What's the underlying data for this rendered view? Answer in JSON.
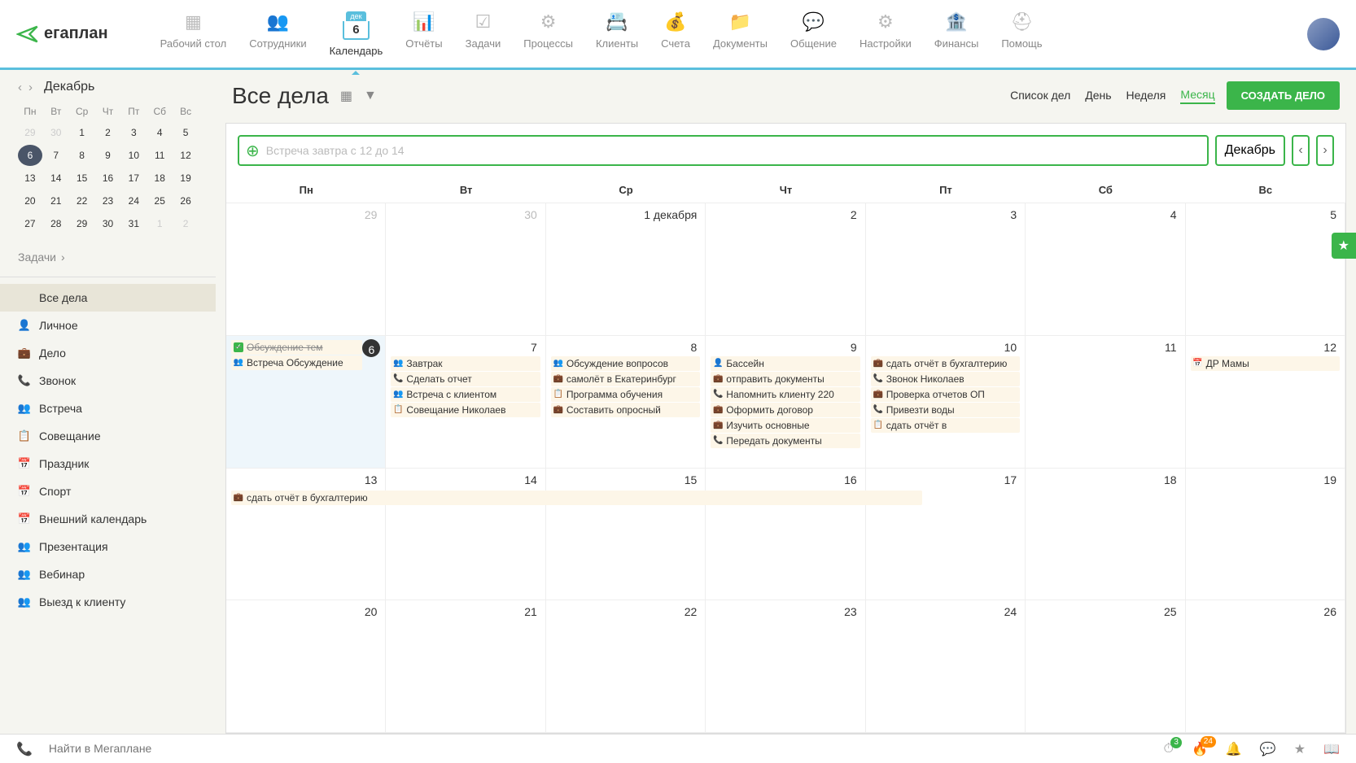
{
  "logo": "егаплан",
  "nav": [
    {
      "label": "Рабочий стол"
    },
    {
      "label": "Сотрудники"
    },
    {
      "label": "Календарь"
    },
    {
      "label": "Отчёты"
    },
    {
      "label": "Задачи"
    },
    {
      "label": "Процессы"
    },
    {
      "label": "Клиенты"
    },
    {
      "label": "Счета"
    },
    {
      "label": "Документы"
    },
    {
      "label": "Общение"
    },
    {
      "label": "Настройки"
    },
    {
      "label": "Финансы"
    },
    {
      "label": "Помощь"
    }
  ],
  "calendarBadge": {
    "month": "дек",
    "day": "6"
  },
  "miniCal": {
    "month": "Декабрь",
    "dayHeaders": [
      "Пн",
      "Вт",
      "Ср",
      "Чт",
      "Пт",
      "Сб",
      "Вс"
    ],
    "days": [
      {
        "n": "29",
        "muted": true
      },
      {
        "n": "30",
        "muted": true
      },
      {
        "n": "1"
      },
      {
        "n": "2"
      },
      {
        "n": "3"
      },
      {
        "n": "4"
      },
      {
        "n": "5"
      },
      {
        "n": "6",
        "today": true
      },
      {
        "n": "7"
      },
      {
        "n": "8"
      },
      {
        "n": "9"
      },
      {
        "n": "10"
      },
      {
        "n": "11"
      },
      {
        "n": "12"
      },
      {
        "n": "13"
      },
      {
        "n": "14"
      },
      {
        "n": "15"
      },
      {
        "n": "16"
      },
      {
        "n": "17"
      },
      {
        "n": "18"
      },
      {
        "n": "19"
      },
      {
        "n": "20"
      },
      {
        "n": "21"
      },
      {
        "n": "22"
      },
      {
        "n": "23"
      },
      {
        "n": "24"
      },
      {
        "n": "25"
      },
      {
        "n": "26"
      },
      {
        "n": "27"
      },
      {
        "n": "28"
      },
      {
        "n": "29"
      },
      {
        "n": "30"
      },
      {
        "n": "31"
      },
      {
        "n": "1",
        "muted": true
      },
      {
        "n": "2",
        "muted": true
      }
    ]
  },
  "tasksLink": "Задачи",
  "sideItems": [
    {
      "label": "Все дела",
      "icon": "",
      "active": true
    },
    {
      "label": "Личное",
      "icon": "👤",
      "cls": "ic-person"
    },
    {
      "label": "Дело",
      "icon": "💼",
      "cls": "ic-brief"
    },
    {
      "label": "Звонок",
      "icon": "📞",
      "cls": "ic-call"
    },
    {
      "label": "Встреча",
      "icon": "👥",
      "cls": "ic-meet"
    },
    {
      "label": "Совещание",
      "icon": "📋",
      "cls": "ic-conf"
    },
    {
      "label": "Праздник",
      "icon": "📅",
      "cls": "ic-holiday"
    },
    {
      "label": "Спорт",
      "icon": "📅",
      "cls": "ic-sport"
    },
    {
      "label": "Внешний календарь",
      "icon": "📅",
      "cls": "ic-ext"
    },
    {
      "label": "Презентация",
      "icon": "👥",
      "cls": "ic-call"
    },
    {
      "label": "Вебинар",
      "icon": "👥",
      "cls": "ic-sport"
    },
    {
      "label": "Выезд к клиенту",
      "icon": "👥",
      "cls": "ic-brief"
    }
  ],
  "pageTitle": "Все дела",
  "viewTabs": [
    "Список дел",
    "День",
    "Неделя",
    "Месяц"
  ],
  "activeView": "Месяц",
  "createBtn": "СОЗДАТЬ ДЕЛО",
  "quickAdd": {
    "placeholder": "Встреча завтра с 12 до 14",
    "month": "Декабрь"
  },
  "calHeaders": [
    "Пн",
    "Вт",
    "Ср",
    "Чт",
    "Пт",
    "Сб",
    "Вс"
  ],
  "weeks": [
    {
      "days": [
        {
          "num": "29",
          "muted": true,
          "events": []
        },
        {
          "num": "30",
          "muted": true,
          "events": []
        },
        {
          "num": "1 декабря",
          "events": []
        },
        {
          "num": "2",
          "events": []
        },
        {
          "num": "3",
          "events": []
        },
        {
          "num": "4",
          "events": []
        },
        {
          "num": "5",
          "events": []
        }
      ]
    },
    {
      "days": [
        {
          "num": "6",
          "today": true,
          "events": [
            {
              "icon": "✓",
              "cls": "ic-check",
              "text": "Обсуждение тем",
              "done": true
            },
            {
              "icon": "👥",
              "cls": "ic-meet",
              "text": "Встреча Обсуждение"
            }
          ]
        },
        {
          "num": "7",
          "events": [
            {
              "icon": "👥",
              "cls": "ic-meet",
              "text": "Завтрак"
            },
            {
              "icon": "📞",
              "cls": "ic-call",
              "text": "Сделать отчет"
            },
            {
              "icon": "👥",
              "cls": "ic-meet",
              "text": "Встреча с клиентом"
            },
            {
              "icon": "📋",
              "cls": "ic-conf",
              "text": "Совещание Николаев"
            }
          ]
        },
        {
          "num": "8",
          "events": [
            {
              "icon": "👥",
              "cls": "ic-meet",
              "text": "Обсуждение вопросов"
            },
            {
              "icon": "💼",
              "cls": "ic-brief",
              "text": "самолёт в Екатеринбург"
            },
            {
              "icon": "📋",
              "cls": "ic-conf",
              "text": "Программа обучения"
            },
            {
              "icon": "💼",
              "cls": "ic-brief",
              "text": "Составить опросный"
            }
          ]
        },
        {
          "num": "9",
          "events": [
            {
              "icon": "👤",
              "cls": "ic-person",
              "text": "Бассейн"
            },
            {
              "icon": "💼",
              "cls": "ic-brief",
              "text": "отправить документы"
            },
            {
              "icon": "📞",
              "cls": "ic-call",
              "text": "Напомнить клиенту 220"
            },
            {
              "icon": "💼",
              "cls": "ic-brief",
              "text": "Оформить договор"
            },
            {
              "icon": "💼",
              "cls": "ic-brief",
              "text": "Изучить основные"
            },
            {
              "icon": "📞",
              "cls": "ic-call",
              "text": "Передать документы"
            }
          ]
        },
        {
          "num": "10",
          "events": [
            {
              "icon": "💼",
              "cls": "ic-brief",
              "text": "сдать отчёт в бухгалтерию"
            },
            {
              "icon": "📞",
              "cls": "ic-call",
              "text": "Звонок Николаев"
            },
            {
              "icon": "💼",
              "cls": "ic-brief",
              "text": "Проверка отчетов ОП"
            },
            {
              "icon": "📞",
              "cls": "ic-call",
              "text": "Привезти воды"
            },
            {
              "icon": "📋",
              "cls": "ic-conf",
              "text": "сдать отчёт в"
            }
          ]
        },
        {
          "num": "11",
          "events": []
        },
        {
          "num": "12",
          "events": [
            {
              "icon": "📅",
              "cls": "ic-holiday",
              "text": "ДР Мамы"
            }
          ]
        }
      ]
    },
    {
      "spanEvent": {
        "icon": "💼",
        "cls": "ic-brief",
        "text": "сдать отчёт в бухгалтерию"
      },
      "days": [
        {
          "num": "13",
          "events": []
        },
        {
          "num": "14",
          "events": []
        },
        {
          "num": "15",
          "events": []
        },
        {
          "num": "16",
          "events": []
        },
        {
          "num": "17",
          "events": []
        },
        {
          "num": "18",
          "events": []
        },
        {
          "num": "19",
          "events": []
        }
      ]
    },
    {
      "days": [
        {
          "num": "20",
          "events": []
        },
        {
          "num": "21",
          "events": []
        },
        {
          "num": "22",
          "events": []
        },
        {
          "num": "23",
          "events": []
        },
        {
          "num": "24",
          "events": []
        },
        {
          "num": "25",
          "events": []
        },
        {
          "num": "26",
          "events": []
        }
      ]
    }
  ],
  "bottomBar": {
    "searchPlaceholder": "Найти в Мегаплане",
    "badge1": "3",
    "badge2": "24"
  }
}
